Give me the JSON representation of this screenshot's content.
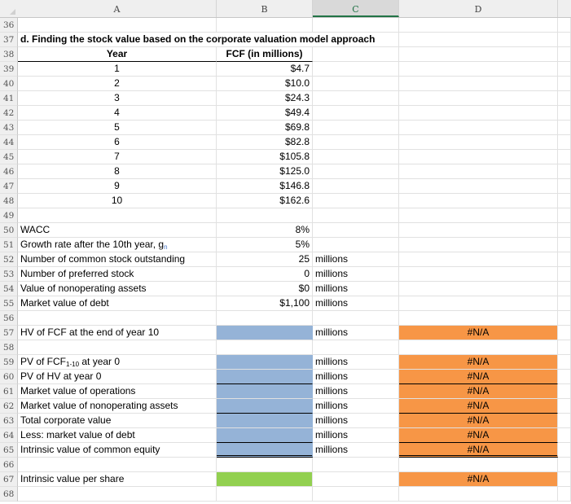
{
  "columns": [
    "A",
    "B",
    "C",
    "D"
  ],
  "selected_column": "C",
  "title": "d. Finding the stock value based on the corporate valuation model approach",
  "table_headers": {
    "year": "Year",
    "fcf": "FCF (in millions)"
  },
  "fcf_rows": [
    {
      "row": "39",
      "year": "1",
      "fcf": "$4.7"
    },
    {
      "row": "40",
      "year": "2",
      "fcf": "$10.0"
    },
    {
      "row": "41",
      "year": "3",
      "fcf": "$24.3"
    },
    {
      "row": "42",
      "year": "4",
      "fcf": "$49.4"
    },
    {
      "row": "43",
      "year": "5",
      "fcf": "$69.8"
    },
    {
      "row": "44",
      "year": "6",
      "fcf": "$82.8"
    },
    {
      "row": "45",
      "year": "7",
      "fcf": "$105.8"
    },
    {
      "row": "46",
      "year": "8",
      "fcf": "$125.0"
    },
    {
      "row": "47",
      "year": "9",
      "fcf": "$146.8"
    },
    {
      "row": "48",
      "year": "10",
      "fcf": "$162.6"
    }
  ],
  "inputs": [
    {
      "row": "50",
      "label": "WACC",
      "value": "8%",
      "unit": ""
    },
    {
      "row": "51",
      "label": "Growth rate after the 10th year, g",
      "sub": "n",
      "value": "5%",
      "unit": ""
    },
    {
      "row": "52",
      "label": "Number of common stock outstanding",
      "value": "25",
      "unit": "millions"
    },
    {
      "row": "53",
      "label": "Number of preferred stock",
      "value": "0",
      "unit": "millions"
    },
    {
      "row": "54",
      "label": "Value of nonoperating assets",
      "value": "$0",
      "unit": "millions"
    },
    {
      "row": "55",
      "label": "Market value of debt",
      "value": "$1,100",
      "unit": "millions"
    }
  ],
  "hv": {
    "row": "57",
    "label": "HV of FCF at the end of year 10",
    "unit": "millions",
    "result": "#N/A"
  },
  "calc_rows": [
    {
      "row": "59",
      "label_pre": "PV of FCF",
      "label_sub": "1-10",
      "label_post": " at year 0",
      "unit": "millions",
      "result": "#N/A"
    },
    {
      "row": "60",
      "label_pre": "PV of HV at year 0",
      "label_sub": "",
      "label_post": "",
      "unit": "millions",
      "result": "#N/A"
    },
    {
      "row": "61",
      "label_pre": "Market value of operations",
      "label_sub": "",
      "label_post": "",
      "unit": "millions",
      "result": "#N/A"
    },
    {
      "row": "62",
      "label_pre": "Market value of nonoperating assets",
      "label_sub": "",
      "label_post": "",
      "unit": "millions",
      "result": "#N/A"
    },
    {
      "row": "63",
      "label_pre": "Total corporate value",
      "label_sub": "",
      "label_post": "",
      "unit": "millions",
      "result": "#N/A"
    },
    {
      "row": "64",
      "label_pre": "Less: market value of debt",
      "label_sub": "",
      "label_post": "",
      "unit": "millions",
      "result": "#N/A"
    },
    {
      "row": "65",
      "label_pre": "Intrinsic value of common equity",
      "label_sub": "",
      "label_post": "",
      "unit": "millions",
      "result": "#N/A"
    }
  ],
  "per_share": {
    "row": "67",
    "label": "Intrinsic value per share",
    "result": "#N/A"
  },
  "empty_rows": [
    "36",
    "49",
    "56",
    "58",
    "66",
    "68"
  ],
  "colors": {
    "input_blue": "#95b3d7",
    "input_green": "#92d050",
    "result_orange": "#f79646",
    "selected_header": "#217346"
  }
}
